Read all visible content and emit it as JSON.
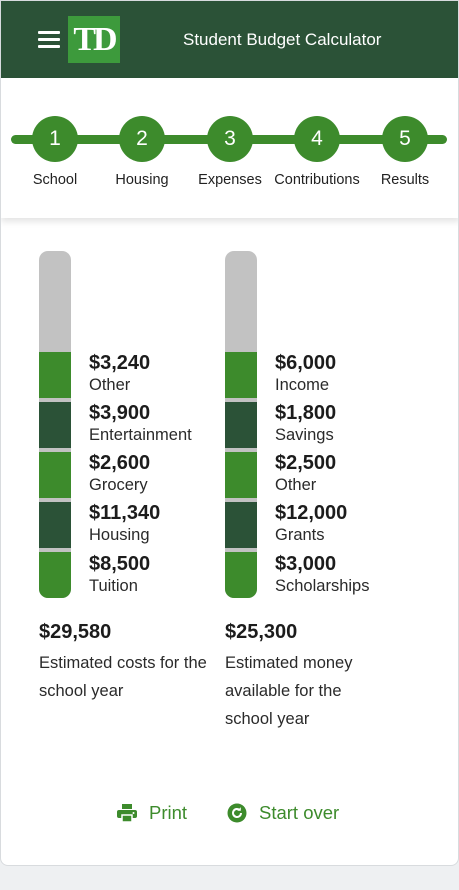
{
  "header": {
    "title": "Student Budget Calculator",
    "logo_text": "TD"
  },
  "colors": {
    "brand_dark": "#2b5237",
    "brand_green": "#3d8b2c",
    "bar_remaining": "#c2c2c2"
  },
  "steps": [
    {
      "number": "1",
      "label": "School"
    },
    {
      "number": "2",
      "label": "Housing"
    },
    {
      "number": "3",
      "label": "Expenses"
    },
    {
      "number": "4",
      "label": "Contributions"
    },
    {
      "number": "5",
      "label": "Results"
    }
  ],
  "costs": {
    "items": [
      {
        "amount": "$3,240",
        "label": "Other"
      },
      {
        "amount": "$3,900",
        "label": "Entertainment"
      },
      {
        "amount": "$2,600",
        "label": "Grocery"
      },
      {
        "amount": "$11,340",
        "label": "Housing"
      },
      {
        "amount": "$8,500",
        "label": "Tuition"
      }
    ],
    "total": "$29,580",
    "caption": "Estimated costs for the school year"
  },
  "money": {
    "items": [
      {
        "amount": "$6,000",
        "label": "Income"
      },
      {
        "amount": "$1,800",
        "label": "Savings"
      },
      {
        "amount": "$2,500",
        "label": "Other"
      },
      {
        "amount": "$12,000",
        "label": "Grants"
      },
      {
        "amount": "$3,000",
        "label": "Scholarships"
      }
    ],
    "total": "$25,300",
    "caption": "Estimated money available for the school year"
  },
  "actions": {
    "print_label": "Print",
    "start_over_label": "Start over",
    "print_icon": "printer-icon",
    "start_over_icon": "refresh-icon"
  }
}
